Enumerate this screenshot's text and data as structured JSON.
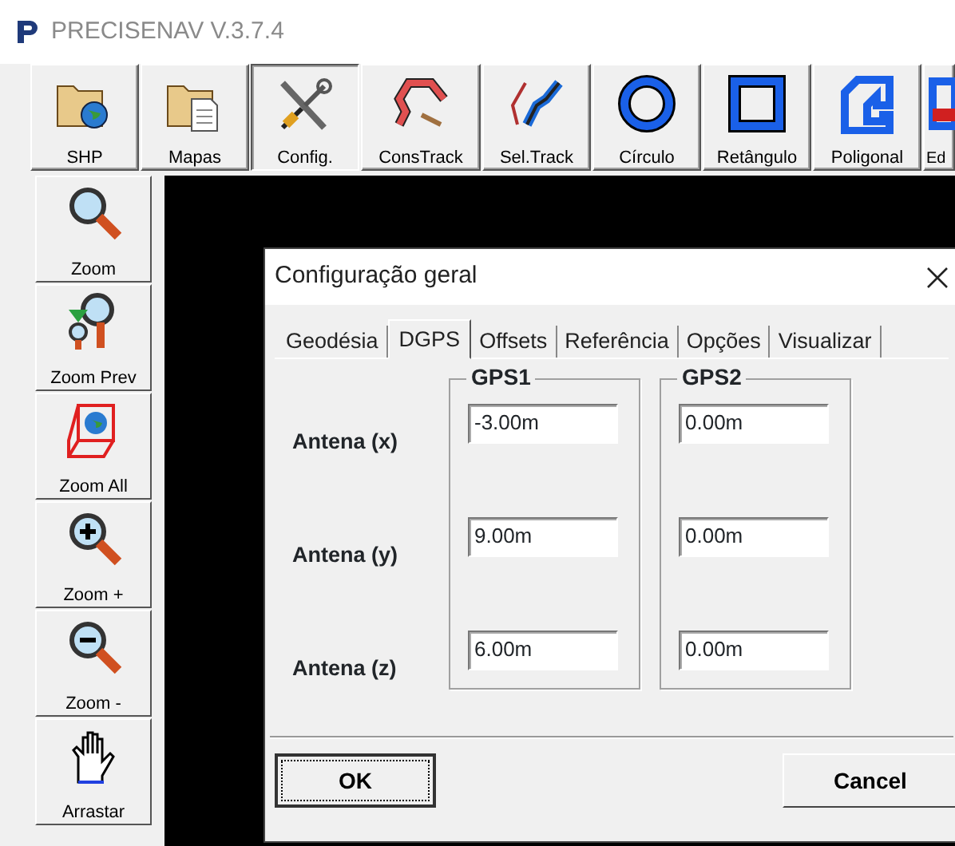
{
  "app": {
    "title": "PRECISENAV V.3.7.4"
  },
  "toolbar": [
    {
      "label": "SHP",
      "selected": false
    },
    {
      "label": "Mapas",
      "selected": false
    },
    {
      "label": "Config.",
      "selected": true
    },
    {
      "label": "ConsTrack",
      "selected": false
    },
    {
      "label": "Sel.Track",
      "selected": false
    },
    {
      "label": "Círculo",
      "selected": false
    },
    {
      "label": "Retângulo",
      "selected": false
    },
    {
      "label": "Poligonal",
      "selected": false
    },
    {
      "label": "Ed",
      "selected": false
    }
  ],
  "side_toolbar": [
    {
      "label": "Zoom"
    },
    {
      "label": "Zoom Prev"
    },
    {
      "label": "Zoom All"
    },
    {
      "label": "Zoom +"
    },
    {
      "label": "Zoom -"
    },
    {
      "label": "Arrastar"
    }
  ],
  "dialog": {
    "title": "Configuração geral",
    "tabs": [
      {
        "label": "Geodésia",
        "selected": false
      },
      {
        "label": "DGPS",
        "selected": true
      },
      {
        "label": "Offsets",
        "selected": false
      },
      {
        "label": "Referência",
        "selected": false
      },
      {
        "label": "Opções",
        "selected": false
      },
      {
        "label": "Visualizar",
        "selected": false
      }
    ],
    "row_labels": [
      "Antena (x)",
      "Antena (y)",
      "Antena (z)"
    ],
    "groups": [
      {
        "title": "GPS1",
        "values": [
          "-3.00m",
          "9.00m",
          "6.00m"
        ]
      },
      {
        "title": "GPS2",
        "values": [
          "0.00m",
          "0.00m",
          "0.00m"
        ]
      }
    ],
    "buttons": [
      {
        "label": "OK",
        "focused": true
      },
      {
        "label": "Cancel",
        "focused": false
      }
    ]
  }
}
